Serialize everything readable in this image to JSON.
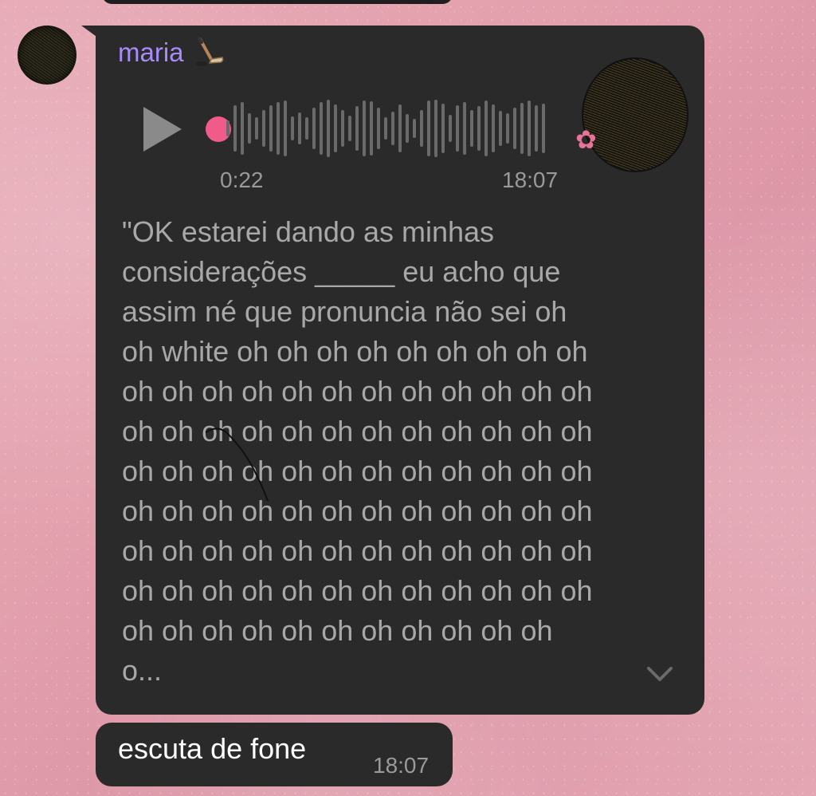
{
  "message": {
    "sender": "maria",
    "sender_color": "#a78bfa",
    "sender_emoji": "hockey-stick-icon",
    "voice": {
      "duration": "0:22",
      "time": "18:07",
      "played_dot_color": "#f05b8a"
    },
    "transcript": "\"OK estarei dando as minhas\nconsiderações _____ eu acho que\nassim né que pronuncia não sei oh\noh white oh oh oh oh oh oh oh oh oh\noh oh oh oh oh oh oh oh oh oh oh oh\noh oh oh oh oh oh oh oh oh oh oh oh\noh oh oh oh oh oh oh oh oh oh oh oh\noh oh oh oh oh oh oh oh oh oh oh oh\noh oh oh oh oh oh oh oh oh oh oh oh\noh oh oh oh oh oh oh oh oh oh oh oh\noh oh oh oh oh oh oh oh oh oh oh\no..."
  },
  "message2": {
    "text": "escuta de fone",
    "time": "18:07"
  }
}
